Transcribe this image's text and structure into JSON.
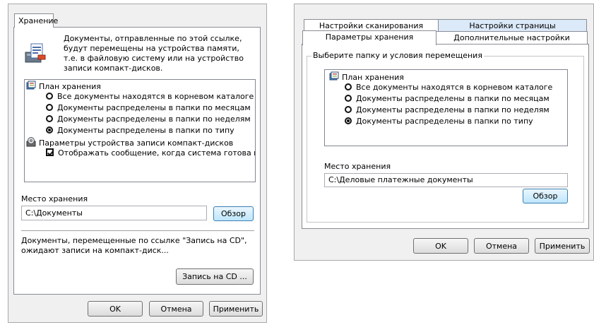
{
  "left": {
    "tab_label": "Хранение",
    "description": "Документы, отправленные по этой ссылке, будут перемещены на устройства памяти, т.е. в файловую систему или на устройство записи компакт-дисков.",
    "tree": {
      "plan_label": "План хранения",
      "options": [
        {
          "label": "Все документы находятся в корневом каталоге",
          "selected": false
        },
        {
          "label": "Документы распределены в папки по месяцам",
          "selected": false
        },
        {
          "label": "Документы распределены в папки по неделям",
          "selected": false
        },
        {
          "label": "Документы распределены в папки по типу",
          "selected": true
        }
      ],
      "cd_params_label": "Параметры устройства записи компакт-дисков",
      "cd_checkbox_label": "Отображать сообщение, когда система готова к з",
      "cd_checkbox_checked": true
    },
    "location_label": "Место хранения",
    "location_value": "C:\\Документы",
    "browse_label": "Обзор",
    "cd_note": "Документы, перемещенные по ссылке \"Запись на CD\", ожидают записи на компакт-диск...",
    "burn_button": "Запись на CD ...",
    "ok": "OK",
    "cancel": "Отмена",
    "apply": "Применить"
  },
  "right": {
    "tabs_row1": [
      "Настройки сканирования",
      "Настройки страницы"
    ],
    "tabs_row2": [
      "Параметры хранения",
      "Дополнительные настройки"
    ],
    "group_label": "Выберите папку и условия перемещения",
    "plan_label": "План хранения",
    "options": [
      {
        "label": "Все документы находятся в корневом каталоге",
        "selected": false
      },
      {
        "label": "Документы распределены в папки по месяцам",
        "selected": false
      },
      {
        "label": "Документы распределены в папки по неделям",
        "selected": false
      },
      {
        "label": "Документы распределены в папки по типу",
        "selected": true
      }
    ],
    "location_label": "Место хранения",
    "location_value": "C:\\Деловые платежные документы",
    "browse_label": "Обзор",
    "ok": "OK",
    "cancel": "Отмена",
    "apply": "Применить"
  },
  "icons": {
    "documents_device": "document-storage-icon",
    "plan": "storage-plan-icon",
    "cd_params": "cd-writer-icon"
  },
  "colors": {
    "dialog_bg": "#f0f0f0",
    "panel_bg": "#ffffff",
    "button_focus": "#3c7fb1",
    "tab_active_blue": "#dbe9f8"
  }
}
